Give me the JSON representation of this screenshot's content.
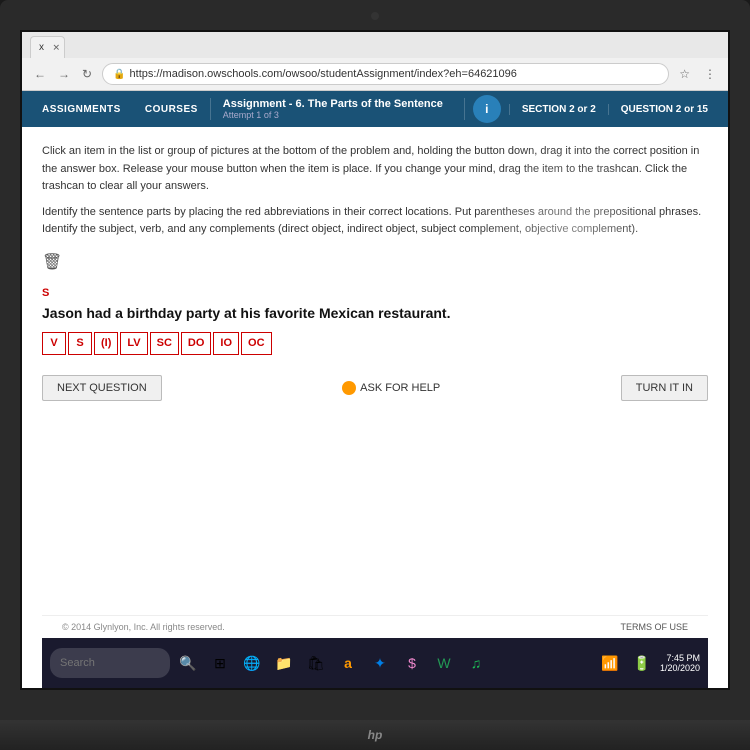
{
  "browser": {
    "tab_label": "x",
    "url": "https://madison.owschools.com/owsoo/studentAssignment/index?eh=64621096",
    "lock_icon": "🔒"
  },
  "navbar": {
    "assignments_label": "ASSIGNMENTS",
    "courses_label": "COURSES",
    "assignment_title": "Assignment - 6. The Parts of the Sentence",
    "assignment_subtitle": "Attempt 1 of 3",
    "info_label": "i",
    "section_label": "SECTION 2 or 2",
    "question_label": "QUESTION 2 or 15"
  },
  "instructions": {
    "line1": "Click an item in the list or group of pictures at the bottom of the problem and, holding the button down, drag it into the correct position in the answer box. Release your mouse button when the item is place. If you change your mind, drag the item to the trashcan. Click the trashcan to clear all your answers.",
    "line2": "Identify the sentence parts by placing the red abbreviations in their correct locations. Put parentheses around the prepositional phrases. Identify the subject, verb, and any complements (direct object, indirect object, subject complement, objective complement)."
  },
  "sentence": {
    "label": "S",
    "text": "Jason had a birthday party at his favorite Mexican restaurant.",
    "answer_boxes": [
      "V",
      "S",
      "(I)",
      "LV",
      "SC",
      "DO",
      "IO",
      "OC"
    ]
  },
  "buttons": {
    "next_question": "NEXT QUESTION",
    "ask_for_help": "ASK FOR HELP",
    "turn_it_in": "TURN IT IN"
  },
  "footer": {
    "copyright": "© 2014 Glynlyon, Inc. All rights reserved.",
    "terms": "TERMS OF USE"
  },
  "taskbar": {
    "search_placeholder": "Search",
    "hp_logo": "hp"
  }
}
